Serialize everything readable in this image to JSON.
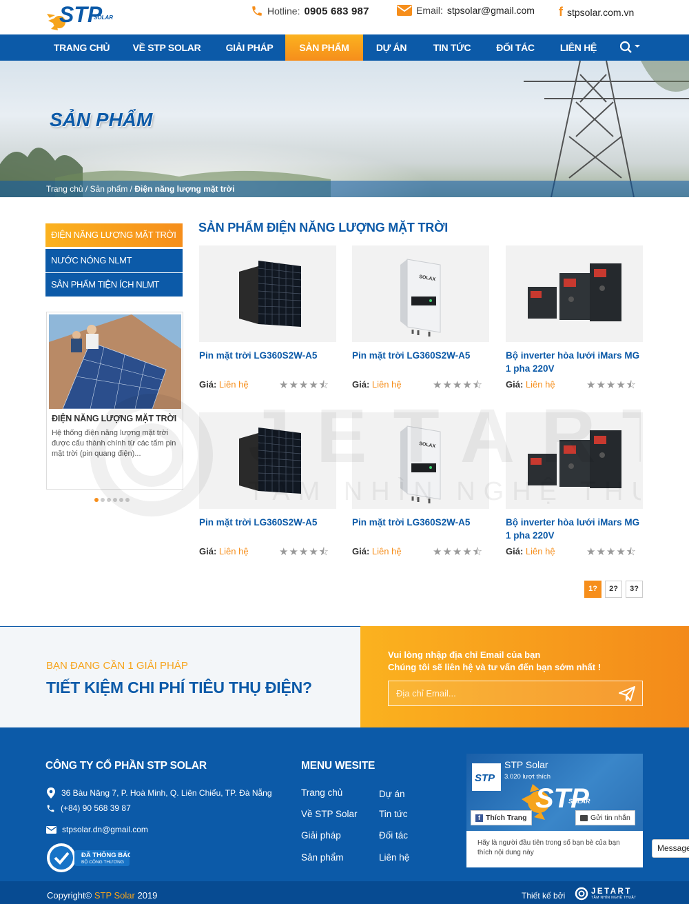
{
  "header": {
    "logo_text": "STP",
    "logo_sub": "SOLAR",
    "hotline_label": "Hotline:",
    "hotline_value": "0905 683 987",
    "email_label": "Email:",
    "email_value": "stpsolar@gmail.com",
    "facebook_value": "stpsolar.com.vn"
  },
  "nav": {
    "items": [
      "TRANG CHỦ",
      "VỀ STP SOLAR",
      "GIẢI PHÁP",
      "SẢN PHẨM",
      "DỰ ÁN",
      "TIN TỨC",
      "ĐỐI TÁC",
      "LIÊN HỆ"
    ],
    "active_index": 3
  },
  "banner": {
    "title": "SẢN PHẨM",
    "breadcrumb_home": "Trang chủ",
    "breadcrumb_sep": " / ",
    "breadcrumb_products": "Sản phẩm",
    "breadcrumb_current": "Điện năng lượng mặt trời"
  },
  "sidebar": {
    "categories": [
      "ĐIỆN NĂNG LƯỢNG MẶT TRỜI",
      "NƯỚC NÓNG NLMT",
      "SẢN PHẨM TIỆN ÍCH NLMT"
    ],
    "card_title": "ĐIỆN NĂNG LƯỢNG MẶT TRỜI",
    "card_text": "Hệ thống điện năng lượng mặt trời được cấu thành chính từ các tấm pin mặt trời (pin quang điện)...",
    "slide_count": 6,
    "active_slide": 0
  },
  "products": {
    "section_title": "SẢN PHẨM ĐIỆN NĂNG LƯỢNG MẶT TRỜI",
    "price_label": "Giá:",
    "price_value": "Liên hệ",
    "items": [
      {
        "name": "Pin mặt trời LG360S2W-A5",
        "image": "solar-panel",
        "rating": 4.5
      },
      {
        "name": "Pin mặt trời LG360S2W-A5",
        "image": "solax-inverter",
        "rating": 4.5
      },
      {
        "name": "Bộ inverter hòa lưới iMars MG 1 pha 220V",
        "image": "imars-inverter",
        "rating": 4.5
      },
      {
        "name": "Pin mặt trời LG360S2W-A5",
        "image": "solar-panel",
        "rating": 4.5
      },
      {
        "name": "Pin mặt trời LG360S2W-A5",
        "image": "solax-inverter",
        "rating": 4.5
      },
      {
        "name": "Bộ inverter hòa lưới iMars MG 1 pha 220V",
        "image": "imars-inverter",
        "rating": 4.5
      }
    ],
    "solax_brand": "SOLAX",
    "pages": [
      "1?",
      "2?",
      "3?"
    ],
    "current_page": 0
  },
  "cta": {
    "sub": "BẠN ĐANG CẦN 1 GIẢI PHÁP",
    "main": "TIẾT KIỆM CHI PHÍ TIÊU THỤ ĐIỆN?",
    "note_line1": "Vui lòng nhập địa chỉ Email của bạn",
    "note_line2": "Chúng tôi sẽ liên hệ và tư vấn đến bạn sớm nhất !",
    "email_placeholder": "Địa chỉ Email..."
  },
  "footer": {
    "company": "CÔNG TY CỔ PHẦN STP SOLAR",
    "address": "36 Bàu Năng 7, P. Hoà Minh, Q. Liên Chiểu, TP. Đà Nẵng",
    "phone": "(+84) 90 568 39 87",
    "email": "stpsolar.dn@gmail.com",
    "badge_title": "ĐÃ THÔNG BÁO",
    "badge_sub": "BỘ CÔNG THƯƠNG",
    "menu_title": "MENU WESITE",
    "menu_col1": [
      "Trang chủ",
      "Về STP Solar",
      "Giải pháp",
      "Sản phẩm"
    ],
    "menu_col2": [
      "Dự án",
      "Tin tức",
      "Đối tác",
      "Liên hệ"
    ],
    "fb_page_name": "STP Solar",
    "fb_likes": "3.020 lượt thích",
    "fb_like_button": "Thích Trang",
    "fb_message_button": "Gửi tin nhắn",
    "fb_text": "Hãy là người đầu tiên trong số bạn bè của bạn thích nội dung này",
    "copyright_prefix": "Copyright©",
    "copyright_brand": "STP Solar",
    "copyright_year": "2019",
    "designed_by": "Thiết kế bởi",
    "designer": "JETART",
    "designer_tagline": "TẦM NHÌN NGHỆ THUẬT",
    "messenger_label": "Message"
  },
  "watermark": {
    "text": "JETART",
    "tagline": "TẦM NHÌN NGHỆ THUẬT"
  },
  "colors": {
    "primary_blue": "#0c5aa8",
    "accent_orange": "#f68e1b"
  }
}
